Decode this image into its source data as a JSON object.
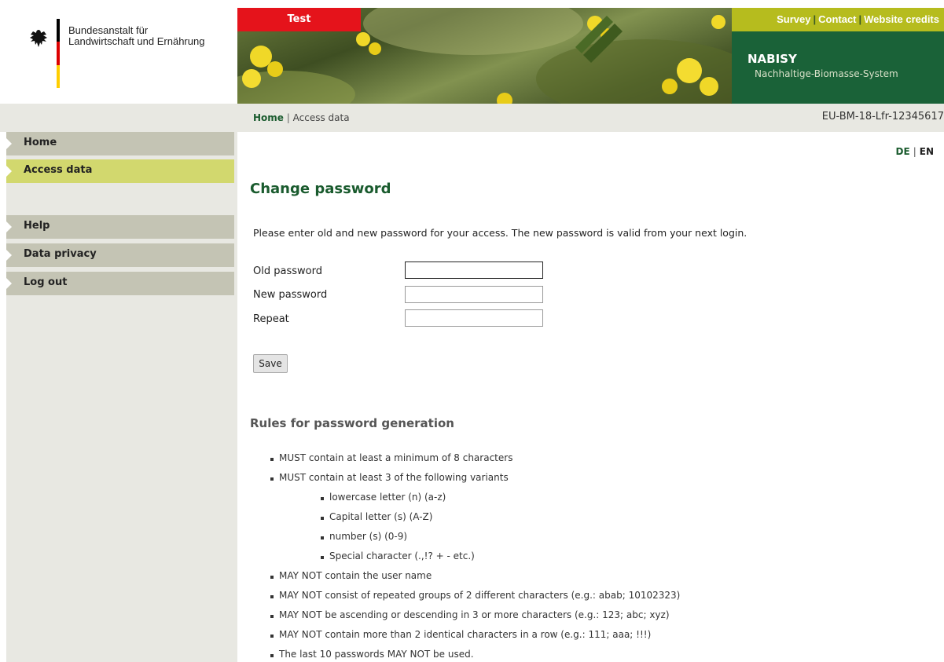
{
  "header": {
    "org_line1": "Bundesanstalt für",
    "org_line2": "Landwirtschaft und Ernährung",
    "test_label": "Test",
    "links": [
      "Survey",
      "Contact",
      "Website credits"
    ],
    "app_title": "NABISY",
    "app_subtitle": "Nachhaltige-Biomasse-System"
  },
  "breadcrumb": {
    "home": "Home",
    "current": "Access data"
  },
  "case_id": "EU-BM-18-Lfr-12345617",
  "language": {
    "de": "DE",
    "en": "EN",
    "active": "DE"
  },
  "sidebar": {
    "items": [
      {
        "label": "Home",
        "active": false
      },
      {
        "label": "Access data",
        "active": true
      },
      {
        "label": "Help",
        "active": false
      },
      {
        "label": "Data privacy",
        "active": false
      },
      {
        "label": "Log out",
        "active": false
      }
    ]
  },
  "form": {
    "title": "Change password",
    "intro": "Please enter old and new password for your access. The new password is valid from your next login.",
    "fields": [
      {
        "label": "Old password",
        "value": ""
      },
      {
        "label": "New password",
        "value": ""
      },
      {
        "label": "Repeat",
        "value": ""
      }
    ],
    "save_label": "Save"
  },
  "rules": {
    "title": "Rules for password generation",
    "items": [
      "MUST contain at least a minimum of 8 characters",
      "MUST contain at least 3 of the following variants",
      "lowercase letter (n) (a-z)",
      "Capital letter (s) (A-Z)",
      "number (s) (0-9)",
      "Special character (.,!? + - etc.)",
      "MAY NOT contain the user name",
      "MAY NOT consist of repeated groups of 2 different characters (e.g.: abab; 10102323)",
      "MAY NOT be ascending or descending in 3 or more characters (e.g.: 123; abc; xyz)",
      "MAY NOT contain more than 2 identical characters in a row (e.g.: 111; aaa; !!!)",
      "The last 10 passwords MAY NOT be used."
    ]
  },
  "colors": {
    "brand_green": "#1a6238",
    "accent_lime": "#b6bc1e",
    "test_red": "#e5131b",
    "nav_active": "#d2d86e",
    "nav_default": "#c4c4b4"
  }
}
